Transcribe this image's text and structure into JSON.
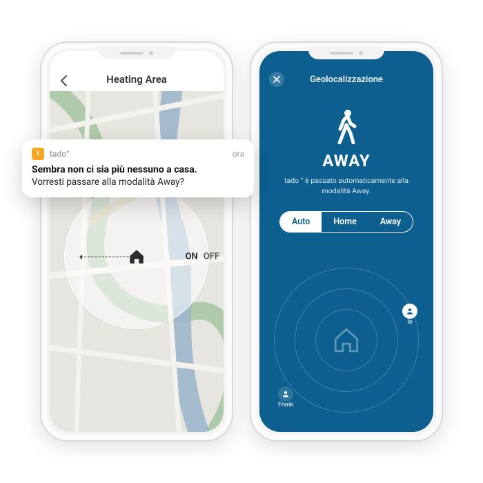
{
  "left": {
    "header_title": "Heating Area",
    "toggle_on": "ON",
    "toggle_off": "OFF"
  },
  "notification": {
    "app_name": "tado°",
    "time": "ora",
    "title": "Sembra non ci sia più nessuno a casa.",
    "body": "Vorresti passare alla modalità Away?"
  },
  "right": {
    "header_title": "Geolocalizzazione",
    "status_label": "AWAY",
    "status_sub": "tado ° è passato automaticamente alla modalità Away.",
    "segments": {
      "auto": "Auto",
      "home": "Home",
      "away": "Away"
    },
    "users": {
      "me": "Io",
      "other": "Frank"
    }
  },
  "colors": {
    "brand_blue": "#0c5f8f",
    "brand_orange": "#f5a623"
  }
}
